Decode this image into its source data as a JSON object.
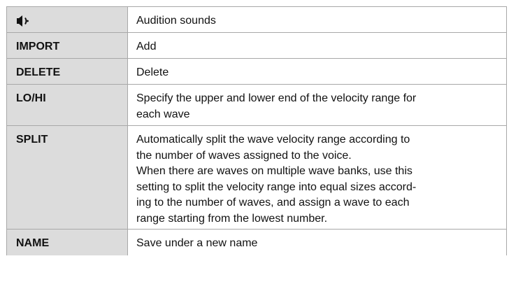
{
  "rows": [
    {
      "key_icon": "speaker-icon",
      "description_lines": [
        "Audition sounds"
      ]
    },
    {
      "key": "IMPORT",
      "description_lines": [
        "Add"
      ]
    },
    {
      "key": "DELETE",
      "description_lines": [
        "Delete"
      ]
    },
    {
      "key": "LO/HI",
      "description_lines": [
        "Specify the upper and lower end of the velocity range for",
        "each wave"
      ]
    },
    {
      "key": "SPLIT",
      "description_lines": [
        "Automatically split the wave velocity range according to",
        "the number of waves assigned to the voice.",
        "When there are waves on multiple wave banks, use this",
        "setting to split the velocity range into equal sizes accord-",
        "ing to the number of waves, and assign a wave to each",
        "range starting from the lowest number."
      ]
    },
    {
      "key": "NAME",
      "description_lines": [
        "Save under a new name"
      ]
    }
  ]
}
